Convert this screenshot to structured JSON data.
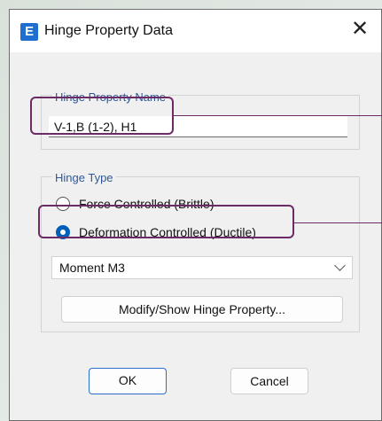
{
  "window": {
    "app_icon_letter": "E",
    "title": "Hinge Property Data",
    "close_glyph": "✕"
  },
  "hinge_property_name": {
    "group_label": "Hinge Property Name",
    "value": "V-1,B (1-2), H1"
  },
  "hinge_type": {
    "group_label": "Hinge Type",
    "options": [
      {
        "label": "Force Controlled  (Brittle)",
        "selected": false
      },
      {
        "label": "Deformation Controlled  (Ductile)",
        "selected": true
      }
    ],
    "dropdown_value": "Moment M3",
    "modify_button": "Modify/Show Hinge Property..."
  },
  "buttons": {
    "ok": "OK",
    "cancel": "Cancel"
  },
  "colors": {
    "accent": "#005fb8",
    "group_label": "#2e5897",
    "annotation": "#6b2b67",
    "app_icon": "#1f6fd1"
  },
  "icons": {
    "app": "app-icon",
    "close": "close-icon",
    "dropdown": "chevron-down-icon"
  }
}
